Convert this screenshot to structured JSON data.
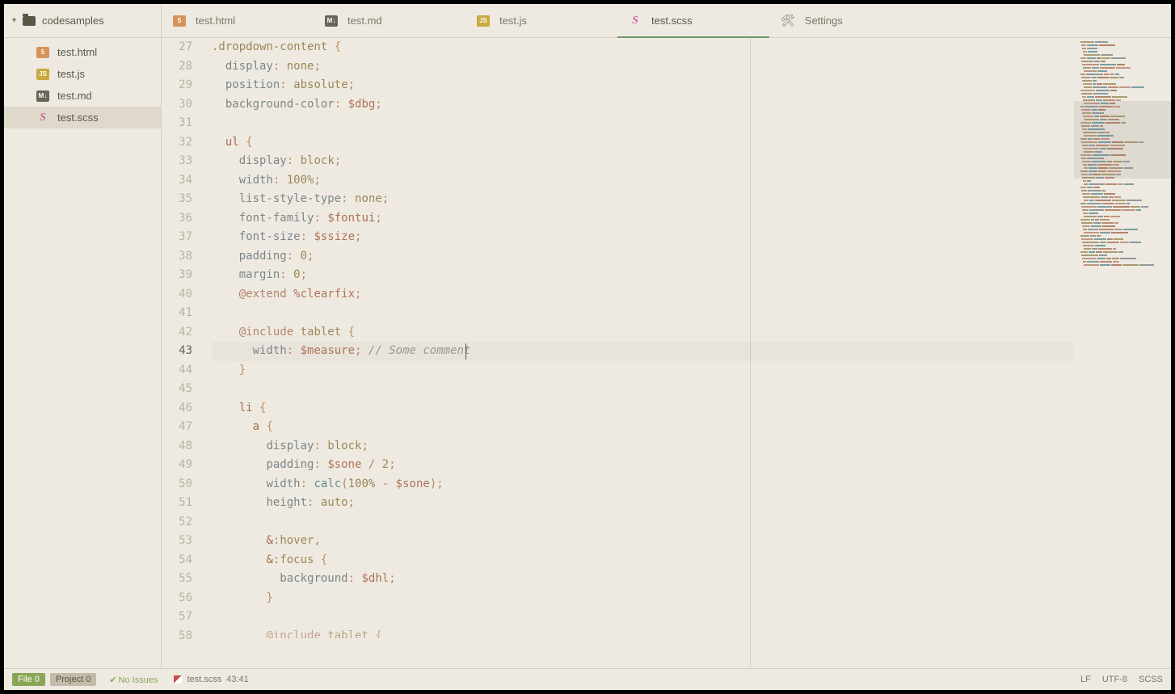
{
  "sidebar": {
    "root": "codesamples",
    "items": [
      {
        "label": "test.html",
        "icon": "html"
      },
      {
        "label": "test.js",
        "icon": "js"
      },
      {
        "label": "test.md",
        "icon": "md"
      },
      {
        "label": "test.scss",
        "icon": "scss",
        "selected": true
      }
    ]
  },
  "tabs": [
    {
      "label": "test.html",
      "icon": "html"
    },
    {
      "label": "test.md",
      "icon": "md"
    },
    {
      "label": "test.js",
      "icon": "js"
    },
    {
      "label": "test.scss",
      "icon": "scss",
      "active": true
    },
    {
      "label": "Settings",
      "icon": "settings"
    }
  ],
  "gutter": {
    "start": 27,
    "end": 58,
    "active": 43
  },
  "code": [
    {
      "n": 27,
      "indent": 0,
      "tokens": [
        [
          "c-class",
          ".dropdown-content"
        ],
        [
          "",
          ""
        ],
        [
          "",
          ""
        ],
        [
          "",
          ""
        ],
        [
          "",
          ""
        ],
        [
          "",
          ""
        ],
        [
          "",
          ""
        ],
        [
          "",
          ""
        ],
        [
          "",
          ""
        ],
        [
          "",
          ""
        ],
        [
          "",
          ""
        ],
        [
          "",
          ""
        ],
        [
          "",
          ""
        ],
        [
          "",
          ""
        ],
        [
          "",
          ""
        ],
        [
          "",
          ""
        ],
        [
          "",
          ""
        ],
        [
          "",
          ""
        ],
        [
          "",
          ""
        ],
        [
          "",
          ""
        ]
      ],
      "raw": "<span class='c-class'>.dropdown-content</span> <span class='c-brace'>{</span>"
    },
    {
      "n": 28,
      "indent": 1,
      "raw": "<span class='c-prop'>display</span><span class='c-punct'>:</span> <span class='c-val'>none</span><span class='c-punct'>;</span>"
    },
    {
      "n": 29,
      "indent": 1,
      "raw": "<span class='c-prop'>position</span><span class='c-punct'>:</span> <span class='c-val'>absolute</span><span class='c-punct'>;</span>"
    },
    {
      "n": 30,
      "indent": 1,
      "raw": "<span class='c-prop'>background-color</span><span class='c-punct'>:</span> <span class='c-var'>$dbg</span><span class='c-punct'>;</span>"
    },
    {
      "n": 31,
      "indent": 1,
      "raw": ""
    },
    {
      "n": 32,
      "indent": 1,
      "raw": "<span class='c-tag'>ul</span> <span class='c-brace'>{</span>"
    },
    {
      "n": 33,
      "indent": 2,
      "raw": "<span class='c-prop'>display</span><span class='c-punct'>:</span> <span class='c-val'>block</span><span class='c-punct'>;</span>"
    },
    {
      "n": 34,
      "indent": 2,
      "raw": "<span class='c-prop'>width</span><span class='c-punct'>:</span> <span class='c-num'>100%</span><span class='c-punct'>;</span>"
    },
    {
      "n": 35,
      "indent": 2,
      "raw": "<span class='c-prop'>list-style-type</span><span class='c-punct'>:</span> <span class='c-val'>none</span><span class='c-punct'>;</span>"
    },
    {
      "n": 36,
      "indent": 2,
      "raw": "<span class='c-prop'>font-family</span><span class='c-punct'>:</span> <span class='c-var'>$fontui</span><span class='c-punct'>;</span>"
    },
    {
      "n": 37,
      "indent": 2,
      "raw": "<span class='c-prop'>font-size</span><span class='c-punct'>:</span> <span class='c-var'>$ssize</span><span class='c-punct'>;</span>"
    },
    {
      "n": 38,
      "indent": 2,
      "raw": "<span class='c-prop'>padding</span><span class='c-punct'>:</span> <span class='c-num'>0</span><span class='c-punct'>;</span>"
    },
    {
      "n": 39,
      "indent": 2,
      "raw": "<span class='c-prop'>margin</span><span class='c-punct'>:</span> <span class='c-num'>0</span><span class='c-punct'>;</span>"
    },
    {
      "n": 40,
      "indent": 2,
      "raw": "<span class='c-at'>@extend</span> <span class='c-var'>%clearfix</span><span class='c-punct'>;</span>"
    },
    {
      "n": 41,
      "indent": 2,
      "raw": ""
    },
    {
      "n": 42,
      "indent": 2,
      "raw": "<span class='c-at'>@include</span> <span class='c-class'>tablet</span> <span class='c-brace'>{</span>"
    },
    {
      "n": 43,
      "indent": 3,
      "current": true,
      "raw": "<span class='c-prop'>width</span><span class='c-punct'>:</span> <span class='c-var'>$measure</span><span class='c-punct'>;</span> <span class='c-comment'>// Some comment </span>"
    },
    {
      "n": 44,
      "indent": 2,
      "raw": "<span class='c-brace'>}</span>"
    },
    {
      "n": 45,
      "indent": 2,
      "raw": ""
    },
    {
      "n": 46,
      "indent": 2,
      "raw": "<span class='c-tag'>li</span> <span class='c-brace'>{</span>"
    },
    {
      "n": 47,
      "indent": 3,
      "raw": "<span class='c-tag'>a</span> <span class='c-brace'>{</span>"
    },
    {
      "n": 48,
      "indent": 4,
      "raw": "<span class='c-prop'>display</span><span class='c-punct'>:</span> <span class='c-val'>block</span><span class='c-punct'>;</span>"
    },
    {
      "n": 49,
      "indent": 4,
      "raw": "<span class='c-prop'>padding</span><span class='c-punct'>:</span> <span class='c-var'>$sone</span> <span class='c-op'>/</span> <span class='c-num'>2</span><span class='c-punct'>;</span>"
    },
    {
      "n": 50,
      "indent": 4,
      "raw": "<span class='c-prop'>width</span><span class='c-punct'>:</span> <span class='c-func'>calc</span><span class='c-punct'>(</span><span class='c-num'>100%</span> <span class='c-op'>-</span> <span class='c-var'>$sone</span><span class='c-punct'>)</span><span class='c-punct'>;</span>"
    },
    {
      "n": 51,
      "indent": 4,
      "raw": "<span class='c-prop'>height</span><span class='c-punct'>:</span> <span class='c-val'>auto</span><span class='c-punct'>;</span>"
    },
    {
      "n": 52,
      "indent": 4,
      "raw": ""
    },
    {
      "n": 53,
      "indent": 4,
      "raw": "<span class='c-tag'>&amp;</span><span class='c-punct'>:</span><span class='c-pseudo'>hover</span><span class='c-punct'>,</span>"
    },
    {
      "n": 54,
      "indent": 4,
      "raw": "<span class='c-tag'>&amp;</span><span class='c-punct'>:</span><span class='c-pseudo'>focus</span> <span class='c-brace'>{</span>"
    },
    {
      "n": 55,
      "indent": 5,
      "raw": "<span class='c-prop'>background</span><span class='c-punct'>:</span> <span class='c-var'>$dhl</span><span class='c-punct'>;</span>"
    },
    {
      "n": 56,
      "indent": 4,
      "raw": "<span class='c-brace'>}</span>"
    },
    {
      "n": 57,
      "indent": 4,
      "raw": ""
    },
    {
      "n": 58,
      "indent": 4,
      "cut": true,
      "raw": "<span class='c-at'>@include</span> <span class='c-class'>tablet</span> <span class='c-brace'>{</span>"
    }
  ],
  "statusbar": {
    "file_pill": "File 0",
    "project_pill": "Project 0",
    "no_issues": "No Issues",
    "filename": "test.scss",
    "cursor": "43:41",
    "right": [
      "LF",
      "UTF-8",
      "SCSS"
    ]
  }
}
